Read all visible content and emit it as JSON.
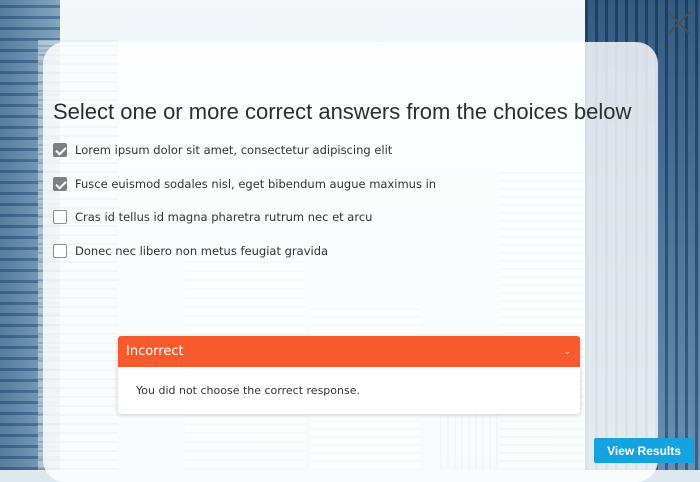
{
  "question": "Select one or more correct answers from the choices below",
  "choices": [
    {
      "label": "Lorem ipsum dolor sit amet, consectetur adipiscing elit",
      "checked": true
    },
    {
      "label": "Fusce euismod sodales nisl, eget bibendum augue maximus in",
      "checked": true
    },
    {
      "label": "Cras id tellus id magna pharetra rutrum nec et arcu",
      "checked": false
    },
    {
      "label": "Donec nec libero non metus feugiat gravida",
      "checked": false
    }
  ],
  "feedback": {
    "title": "Incorrect",
    "message": "You did not choose the correct response.",
    "toggle_icon": "chevron-down-icon"
  },
  "buttons": {
    "view_results": "View Results"
  },
  "icons": {
    "close": "close-icon"
  },
  "colors": {
    "feedback_header": "#f75b2d",
    "primary_button": "#15a3e0",
    "checked_box": "#7c7f83"
  }
}
